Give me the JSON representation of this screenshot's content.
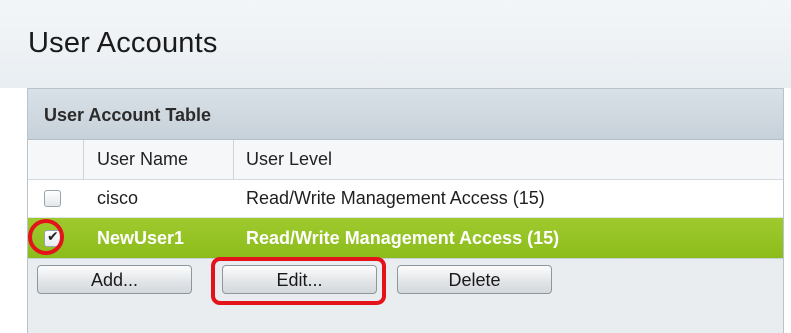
{
  "page": {
    "title": "User Accounts"
  },
  "table": {
    "title": "User Account Table",
    "columns": [
      "",
      "User Name",
      "User Level"
    ],
    "rows": [
      {
        "selected": false,
        "user_name": "cisco",
        "user_level": "Read/Write Management Access (15)"
      },
      {
        "selected": true,
        "user_name": "NewUser1",
        "user_level": "Read/Write Management Access (15)"
      }
    ]
  },
  "buttons": {
    "add": "Add...",
    "edit": "Edit...",
    "delete": "Delete"
  },
  "colors": {
    "selected_row": "#94c226",
    "highlight_annotation": "#e3121b"
  },
  "icons": {
    "checked": "✔"
  }
}
